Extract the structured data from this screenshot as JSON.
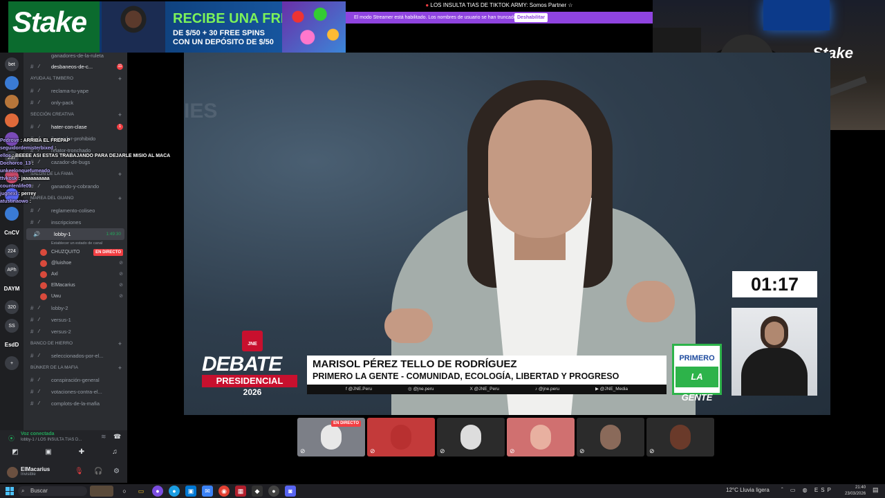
{
  "banner": {
    "logo": "Stake",
    "headline": "RECIBE UNA FREEBET",
    "sub_line1": "DE $/50 + 30 FREE SPINS",
    "sub_line2": "CON UN DEPÓSITO DE $/50"
  },
  "stream": {
    "title": "LOS INSULTA TIAS DE TIKTOK ARMY: Somos Partner ☆",
    "streamer_notice": "El modo Streamer está habilitado. Los nombres de usuario se han truncado.",
    "disable_label": "Deshabilitar"
  },
  "webcam": {
    "watermark": "Stake"
  },
  "servers": [
    {
      "label": "bet"
    },
    {
      "label": ""
    },
    {
      "label": ""
    },
    {
      "label": ""
    },
    {
      "label": ""
    },
    {
      "label": "237"
    },
    {
      "label": ""
    },
    {
      "label": ""
    },
    {
      "label": ""
    },
    {
      "label": "CnCV"
    },
    {
      "label": "224"
    },
    {
      "label": "APh"
    },
    {
      "label": "DAYM"
    },
    {
      "label": "320"
    },
    {
      "label": "SS"
    },
    {
      "label": "EsdD"
    },
    {
      "label": "+"
    }
  ],
  "channels": {
    "top_partial": "ganadores-de-la-ruleta",
    "items_a": [
      {
        "name": "desbaneos-de-c...",
        "badge": "11"
      }
    ],
    "cat_ayuda": "AYUDA AL TIMBERO",
    "items_b": [
      {
        "name": "reclama-tu-yape"
      },
      {
        "name": "only-pack"
      }
    ],
    "cat_creativa": "SECCIÓN CREATIVA",
    "items_c": [
      {
        "name": "hater-con-clase",
        "badge": "1"
      },
      {
        "name": "ilustrador-prohibido"
      },
      {
        "name": "relator-tronchado"
      },
      {
        "name": "cazador-de-bugs"
      }
    ],
    "cat_salon": "SALÓN DE LA FAMA",
    "items_d": [
      {
        "name": "ganando-y-cobrando"
      }
    ],
    "cat_guano": "MAREA DEL GUANO",
    "items_e": [
      {
        "name": "reglamento-coliseo"
      },
      {
        "name": "inscripciones"
      }
    ],
    "lobby": {
      "name": "lobby-1",
      "time": "1:49:30",
      "status": "Establecer un estado de canal"
    },
    "voice_users": [
      {
        "name": "CHUZQUITO",
        "live": "EN DIRECTO"
      },
      {
        "name": "@luishoe"
      },
      {
        "name": "Axl"
      },
      {
        "name": "ElMacarius"
      },
      {
        "name": "Uwu"
      }
    ],
    "items_f": [
      {
        "name": "lobby-2"
      },
      {
        "name": "versus-1"
      },
      {
        "name": "versus-2"
      }
    ],
    "cat_banco": "BANCO DE HIERRO",
    "items_g": [
      {
        "name": "seleccionados-por-el..."
      }
    ],
    "cat_bunker": "BÚNKER DE LA MAFIA",
    "items_h": [
      {
        "name": "conspiración-general"
      },
      {
        "name": "votaciones-contra-el..."
      },
      {
        "name": "complots-de-la-mafia"
      }
    ]
  },
  "chat": [
    {
      "user": "Pedrove",
      "msg": ": ARRIBA EL FREPAP"
    },
    {
      "user": "seguidordemisterbixed",
      "msg": ":"
    },
    {
      "user": "ellos",
      "msg": ": BEEEE ASI ESTAS TRABAJANDO PARA DEJARLE MISIO AL MACA"
    },
    {
      "user": "Dochorco_13",
      "msg": ":"
    },
    {
      "user": "unkeelonquefumeado",
      "msg": ""
    },
    {
      "user": "ttvkosk",
      "msg": ": jaaaaaaaaaa"
    },
    {
      "user": "countenlife09",
      "msg": ""
    },
    {
      "user": "jugnexl",
      "msg": ": perrey"
    },
    {
      "user": "atustinaowo",
      "msg": ":"
    }
  ],
  "voice_panel": {
    "connected": "Voz conectada",
    "channel": "lobby-1 / LOS INSULTA TIAS D..."
  },
  "user_panel": {
    "name": "ElMacarius",
    "status": "Invisible"
  },
  "video": {
    "bg_text": "IES",
    "debate_org": "JNE",
    "debate_word": "DEBATE",
    "debate_sub": "PRESIDENCIAL",
    "debate_year": "2026",
    "candidate_name": "MARISOL PÉREZ TELLO DE RODRÍGUEZ",
    "candidate_party": "PRIMERO LA GENTE - COMUNIDAD, ECOLOGÍA, LIBERTAD Y PROGRESO",
    "socials": [
      "f @JNE.Peru",
      "◎ @jne.peru",
      "X @JNE_Peru",
      "♪ @jne.peru",
      "▶ @JNE_Media"
    ],
    "party_logo_1": "PRIMERO",
    "party_logo_2": "LA GENTE",
    "timer": "01:17"
  },
  "tiles": [
    {
      "live": "EN DIRECTO",
      "bg": "#7c7f87"
    },
    {
      "live": "",
      "bg": "#c33a3a"
    },
    {
      "live": "",
      "bg": "#2b2b2b"
    },
    {
      "live": "",
      "bg": "#d07070"
    },
    {
      "live": "",
      "bg": "#2b2b2b"
    },
    {
      "live": "",
      "bg": "#2b2b2b"
    }
  ],
  "taskbar": {
    "search": "Buscar",
    "weather": "12°C  Lluvia ligera",
    "tray": "ˆ ▭ ◍ ESP",
    "time": "21:40",
    "date": "23/03/2026"
  }
}
